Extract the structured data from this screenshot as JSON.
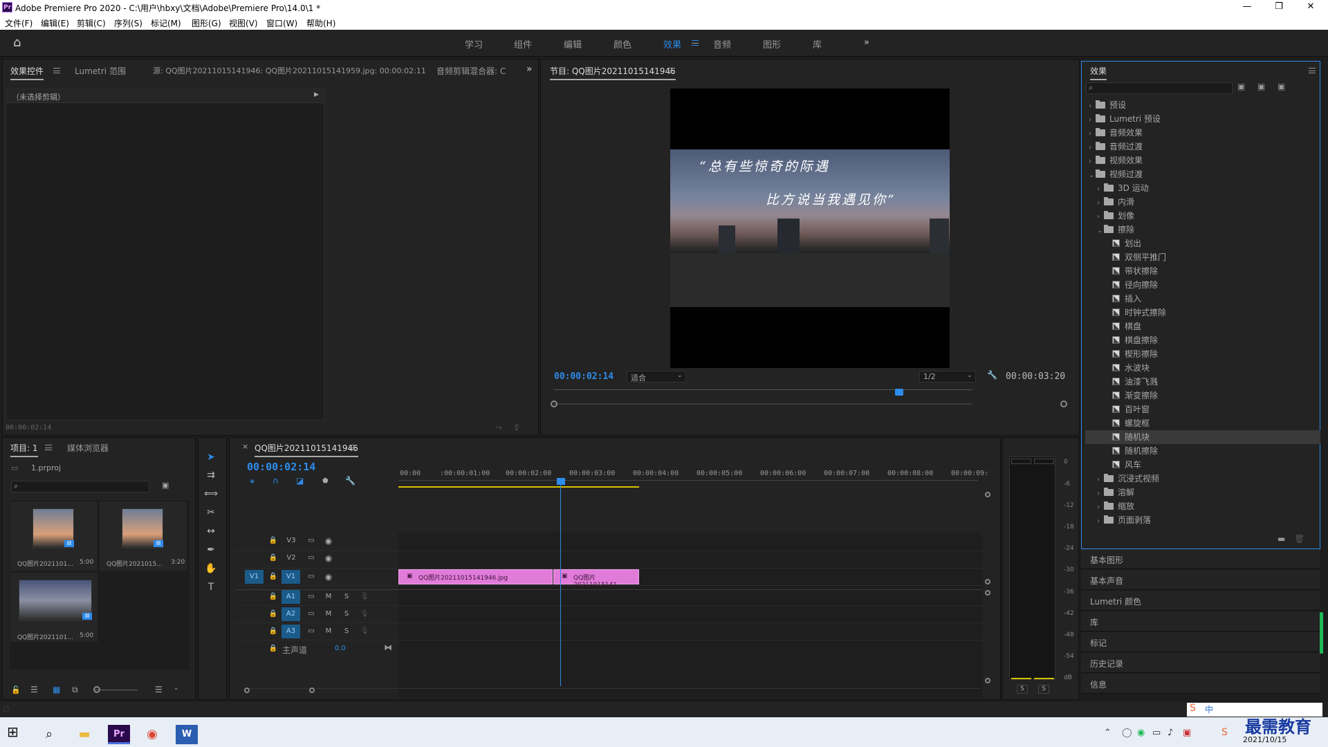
{
  "window": {
    "title": "Adobe Premiere Pro 2020 - C:\\用户\\hbxy\\文档\\Adobe\\Premiere Pro\\14.0\\1 *",
    "logo": "Pr"
  },
  "menu": [
    "文件(F)",
    "编辑(E)",
    "剪辑(C)",
    "序列(S)",
    "标记(M)",
    "图形(G)",
    "视图(V)",
    "窗口(W)",
    "帮助(H)"
  ],
  "workspaces": {
    "tabs": [
      "学习",
      "组件",
      "编辑",
      "颜色",
      "效果",
      "音频",
      "图形",
      "库"
    ],
    "active": "效果"
  },
  "source_panel": {
    "tabs": [
      "效果控件",
      "Lumetri 范围",
      "源: QQ图片20211015141946: QQ图片20211015141959.jpg: 00:00:02:11",
      "音频剪辑混合器: C"
    ],
    "no_clip": "（未选择剪辑）",
    "timecode": "00:00:02:14"
  },
  "program": {
    "title": "节目: QQ图片20211015141946",
    "caption_line1": "“总有些惊奇的际遇",
    "caption_line2": "比方说当我遇见你”",
    "timecode": "00:00:02:14",
    "fit": "适合",
    "quality": "1/2",
    "duration": "00:00:03:20"
  },
  "project": {
    "tabs": [
      "项目: 1",
      "媒体浏览器"
    ],
    "file": "1.prproj",
    "items": [
      {
        "name": "QQ图片2021101...",
        "dur": "5:00"
      },
      {
        "name": "QQ图片2021015...",
        "dur": "3:20"
      },
      {
        "name": "QQ图片2021101...",
        "dur": "5:00"
      }
    ]
  },
  "timeline": {
    "title": "QQ图片20211015141946",
    "timecode": "00:00:02:14",
    "ruler": [
      "00:00",
      ":00:00:01:00",
      "00:00:02:00",
      "00:00:03:00",
      "00:00:04:00",
      "00:00:05:00",
      "00:00:06:00",
      "00:00:07:00",
      "00:00:08:00",
      "00:00:09:"
    ],
    "tracks": [
      "V3",
      "V2",
      "V1",
      "A1",
      "A2",
      "A3"
    ],
    "master": "主声道",
    "master_val": "0.0",
    "clip1": "QQ图片20211015141946.jpg",
    "clip2": "QQ图片20211015141"
  },
  "meter": {
    "labels": [
      "0",
      "-6",
      "-12",
      "-18",
      "-24",
      "-30",
      "-36",
      "-42",
      "-48",
      "-54",
      "dB"
    ],
    "s": "S"
  },
  "effects": {
    "title": "效果",
    "rows": [
      {
        "d": 0,
        "t": "folder",
        "c": "›",
        "l": "预设"
      },
      {
        "d": 0,
        "t": "folder",
        "c": "›",
        "l": "Lumetri 预设"
      },
      {
        "d": 0,
        "t": "folder",
        "c": "›",
        "l": "音频效果"
      },
      {
        "d": 0,
        "t": "folder",
        "c": "›",
        "l": "音频过渡"
      },
      {
        "d": 0,
        "t": "folder",
        "c": "›",
        "l": "视频效果"
      },
      {
        "d": 0,
        "t": "folder",
        "c": "⌄",
        "l": "视频过渡"
      },
      {
        "d": 1,
        "t": "folder",
        "c": "›",
        "l": "3D 运动"
      },
      {
        "d": 1,
        "t": "folder",
        "c": "›",
        "l": "内滑"
      },
      {
        "d": 1,
        "t": "folder",
        "c": "›",
        "l": "划像"
      },
      {
        "d": 1,
        "t": "folder",
        "c": "⌄",
        "l": "擦除"
      },
      {
        "d": 2,
        "t": "fx",
        "l": "划出"
      },
      {
        "d": 2,
        "t": "fx",
        "l": "双侧平推门"
      },
      {
        "d": 2,
        "t": "fx",
        "l": "带状擦除"
      },
      {
        "d": 2,
        "t": "fx",
        "l": "径向擦除"
      },
      {
        "d": 2,
        "t": "fx",
        "l": "插入"
      },
      {
        "d": 2,
        "t": "fx",
        "l": "时钟式擦除"
      },
      {
        "d": 2,
        "t": "fx",
        "l": "棋盘"
      },
      {
        "d": 2,
        "t": "fx",
        "l": "棋盘擦除"
      },
      {
        "d": 2,
        "t": "fx",
        "l": "楔形擦除"
      },
      {
        "d": 2,
        "t": "fx",
        "l": "水波块"
      },
      {
        "d": 2,
        "t": "fx",
        "l": "油漆飞溅"
      },
      {
        "d": 2,
        "t": "fx",
        "l": "渐变擦除"
      },
      {
        "d": 2,
        "t": "fx",
        "l": "百叶窗"
      },
      {
        "d": 2,
        "t": "fx",
        "l": "螺旋框"
      },
      {
        "d": 2,
        "t": "fx",
        "l": "随机块",
        "sel": true
      },
      {
        "d": 2,
        "t": "fx",
        "l": "随机擦除"
      },
      {
        "d": 2,
        "t": "fx",
        "l": "风车"
      },
      {
        "d": 1,
        "t": "folder",
        "c": "›",
        "l": "沉浸式视频"
      },
      {
        "d": 1,
        "t": "folder",
        "c": "›",
        "l": "溶解"
      },
      {
        "d": 1,
        "t": "folder",
        "c": "›",
        "l": "缩放"
      },
      {
        "d": 1,
        "t": "folder",
        "c": "›",
        "l": "页面剥落"
      }
    ]
  },
  "side_panels": [
    "基本图形",
    "基本声音",
    "Lumetri 颜色",
    "库",
    "标记",
    "历史记录",
    "信息"
  ],
  "taskbar": {
    "date": "2021/10/15",
    "watermark": "最需教育"
  }
}
